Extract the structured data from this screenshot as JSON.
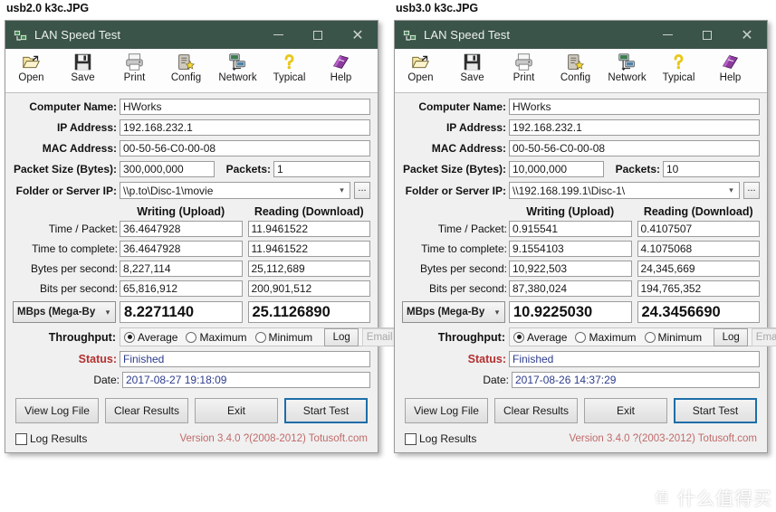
{
  "panels": [
    {
      "file_label": "usb2.0 k3c.JPG",
      "window": {
        "title": "LAN Speed Test",
        "title_icon": "app-network-icon",
        "minimize": "–",
        "maximize": "□",
        "close": "✕"
      },
      "toolbar": [
        {
          "label": "Open",
          "icon": "open-folder-icon"
        },
        {
          "label": "Save",
          "icon": "floppy-disk-icon"
        },
        {
          "label": "Print",
          "icon": "printer-icon"
        },
        {
          "label": "Config",
          "icon": "config-gear-icon"
        },
        {
          "label": "Network",
          "icon": "network-icon"
        },
        {
          "label": "Typical",
          "icon": "question-mark-icon"
        },
        {
          "label": "Help",
          "icon": "help-book-icon"
        }
      ],
      "form": {
        "computer_name_label": "Computer Name:",
        "computer_name_value": "HWorks",
        "ip_address_label": "IP Address:",
        "ip_address_value": "192.168.232.1",
        "mac_address_label": "MAC Address:",
        "mac_address_value": "00-50-56-C0-00-08",
        "packet_size_label": "Packet Size (Bytes):",
        "packet_size_value": "300,000,000",
        "packets_label": "Packets:",
        "packets_value": "1",
        "folder_label": "Folder or Server IP:",
        "folder_value": "\\\\p.to\\Disc-1\\movie",
        "browse_button": "...",
        "dropdown_arrow": "∨"
      },
      "results": {
        "col_writing": "Writing (Upload)",
        "col_reading": "Reading (Download)",
        "rows": [
          {
            "label": "Time / Packet:",
            "writing": "36.4647928",
            "reading": "11.9461522"
          },
          {
            "label": "Time to complete:",
            "writing": "36.4647928",
            "reading": "11.9461522"
          },
          {
            "label": "Bytes per second:",
            "writing": "8,227,114",
            "reading": "25,112,689"
          },
          {
            "label": "Bits per second:",
            "writing": "65,816,912",
            "reading": "200,901,512"
          }
        ],
        "unit_label": "MBps (Mega-By",
        "unit_arrow": "∨",
        "big_writing": "8.2271140",
        "big_reading": "25.1126890"
      },
      "throughput": {
        "label": "Throughput:",
        "options": [
          {
            "label": "Average",
            "selected": true
          },
          {
            "label": "Maximum",
            "selected": false
          },
          {
            "label": "Minimum",
            "selected": false
          }
        ],
        "log_button": "Log",
        "email_button": "Email"
      },
      "status": {
        "label": "Status:",
        "value": "Finished"
      },
      "date": {
        "label": "Date:",
        "value": "2017-08-27 19:18:09"
      },
      "buttons": [
        {
          "label": "View Log File",
          "primary": false
        },
        {
          "label": "Clear Results",
          "primary": false
        },
        {
          "label": "Exit",
          "primary": false
        },
        {
          "label": "Start Test",
          "primary": true
        }
      ],
      "footer": {
        "log_results": "Log Results",
        "version": "Version 3.4.0  ?(2008-2012) Totusoft.com"
      }
    },
    {
      "file_label": "usb3.0 k3c.JPG",
      "window": {
        "title": "LAN Speed Test",
        "title_icon": "app-network-icon",
        "minimize": "–",
        "maximize": "□",
        "close": "✕"
      },
      "toolbar": [
        {
          "label": "Open",
          "icon": "open-folder-icon"
        },
        {
          "label": "Save",
          "icon": "floppy-disk-icon"
        },
        {
          "label": "Print",
          "icon": "printer-icon"
        },
        {
          "label": "Config",
          "icon": "config-gear-icon"
        },
        {
          "label": "Network",
          "icon": "network-icon"
        },
        {
          "label": "Typical",
          "icon": "question-mark-icon"
        },
        {
          "label": "Help",
          "icon": "help-book-icon"
        }
      ],
      "form": {
        "computer_name_label": "Computer Name:",
        "computer_name_value": "HWorks",
        "ip_address_label": "IP Address:",
        "ip_address_value": "192.168.232.1",
        "mac_address_label": "MAC Address:",
        "mac_address_value": "00-50-56-C0-00-08",
        "packet_size_label": "Packet Size (Bytes):",
        "packet_size_value": "10,000,000",
        "packets_label": "Packets:",
        "packets_value": "10",
        "folder_label": "Folder or Server IP:",
        "folder_value": "\\\\192.168.199.1\\Disc-1\\",
        "browse_button": "...",
        "dropdown_arrow": "∨"
      },
      "results": {
        "col_writing": "Writing (Upload)",
        "col_reading": "Reading (Download)",
        "rows": [
          {
            "label": "Time / Packet:",
            "writing": "0.915541",
            "reading": "0.4107507"
          },
          {
            "label": "Time to complete:",
            "writing": "9.1554103",
            "reading": "4.1075068"
          },
          {
            "label": "Bytes per second:",
            "writing": "10,922,503",
            "reading": "24,345,669"
          },
          {
            "label": "Bits per second:",
            "writing": "87,380,024",
            "reading": "194,765,352"
          }
        ],
        "unit_label": "MBps (Mega-By",
        "unit_arrow": "∨",
        "big_writing": "10.9225030",
        "big_reading": "24.3456690"
      },
      "throughput": {
        "label": "Throughput:",
        "options": [
          {
            "label": "Average",
            "selected": true
          },
          {
            "label": "Maximum",
            "selected": false
          },
          {
            "label": "Minimum",
            "selected": false
          }
        ],
        "log_button": "Log",
        "email_button": "Email"
      },
      "status": {
        "label": "Status:",
        "value": "Finished"
      },
      "date": {
        "label": "Date:",
        "value": "2017-08-26 14:37:29"
      },
      "buttons": [
        {
          "label": "View Log File",
          "primary": false
        },
        {
          "label": "Clear Results",
          "primary": false
        },
        {
          "label": "Exit",
          "primary": false
        },
        {
          "label": "Start Test",
          "primary": true
        }
      ],
      "footer": {
        "log_results": "Log Results",
        "version": "Version 3.4.0  ?(2003-2012) Totusoft.com"
      }
    }
  ],
  "watermark": {
    "mark": "值",
    "text": "什么值得买"
  },
  "colors": {
    "titlebar": "#3b5449",
    "status_label": "#b43030",
    "value_text": "#2d3c8c",
    "version_text": "#c16a6a",
    "primary_border": "#1d6ea8"
  }
}
